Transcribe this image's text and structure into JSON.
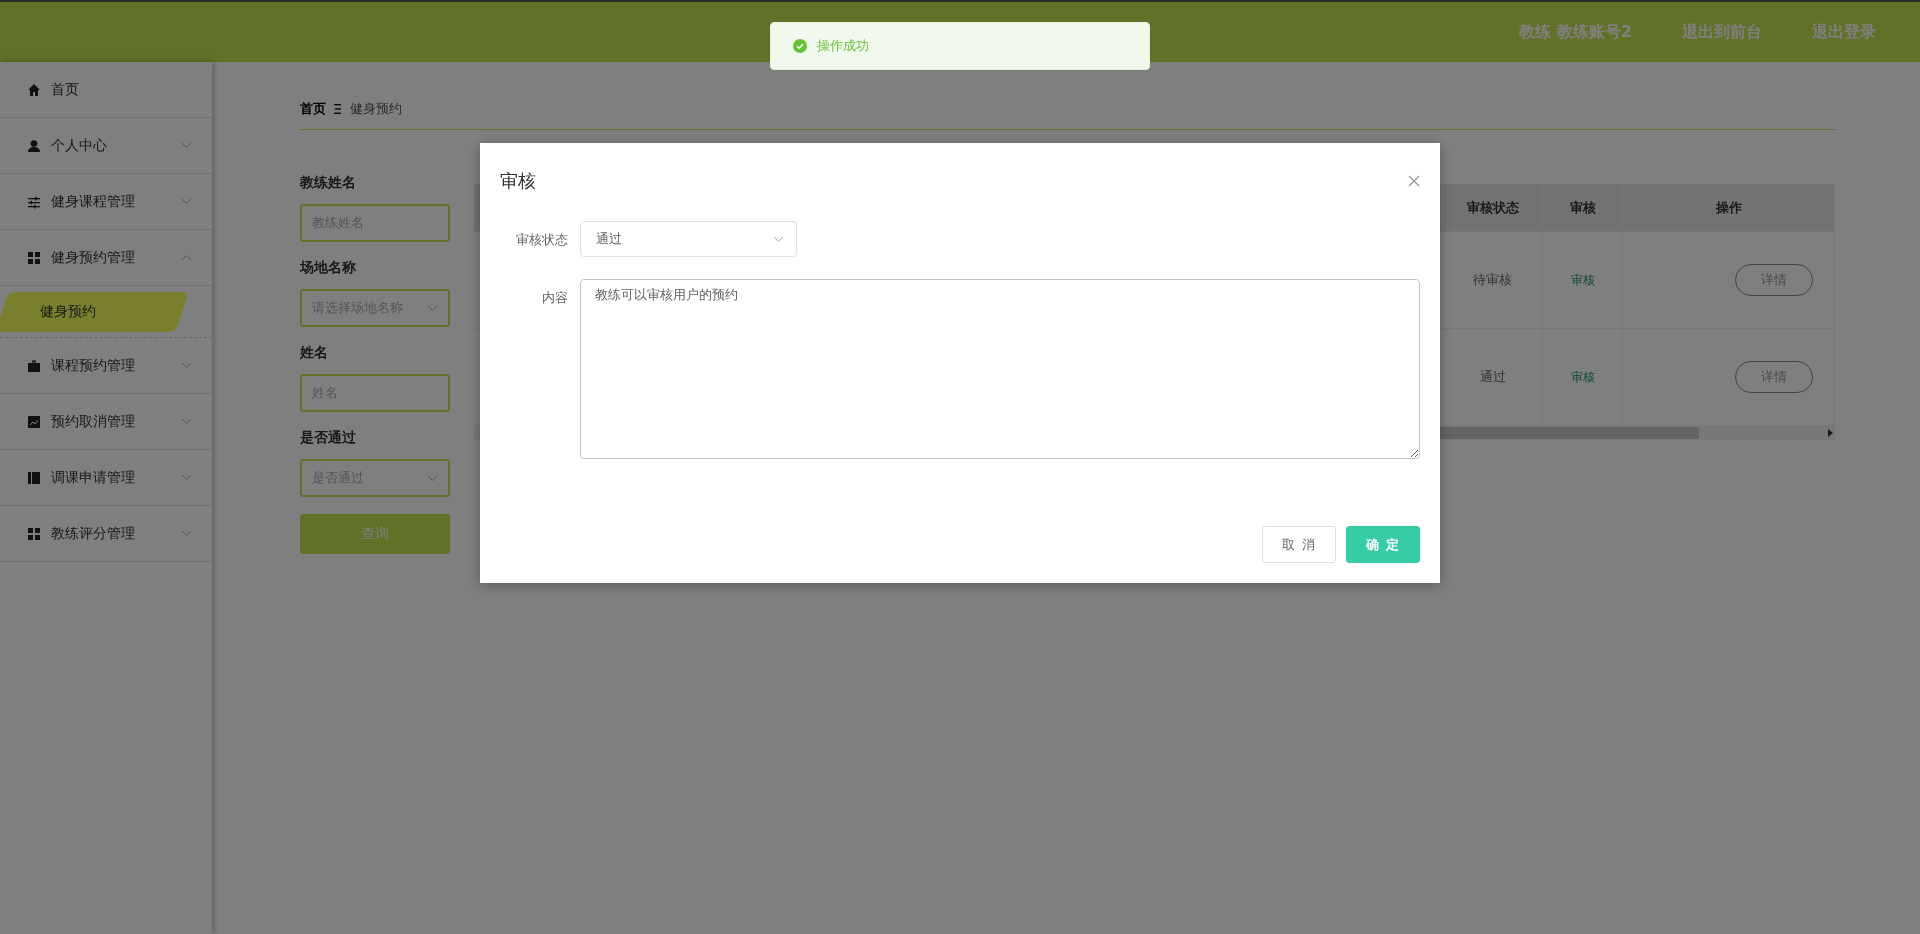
{
  "topbar": {
    "user_label": "教练 教练账号2",
    "links": [
      "退出到前台",
      "退出登录"
    ]
  },
  "toast": {
    "text": "操作成功"
  },
  "sidebar": {
    "items": [
      {
        "label": "首页"
      },
      {
        "label": "个人中心",
        "expanded": false
      },
      {
        "label": "健身课程管理",
        "expanded": false
      },
      {
        "label": "健身预约管理",
        "expanded": true,
        "children": [
          {
            "label": "健身预约",
            "selected": true
          }
        ]
      },
      {
        "label": "课程预约管理",
        "expanded": false
      },
      {
        "label": "预约取消管理",
        "expanded": false
      },
      {
        "label": "调课申请管理",
        "expanded": false
      },
      {
        "label": "教练评分管理",
        "expanded": false
      }
    ]
  },
  "breadcrumb": [
    "首页",
    "健身预约"
  ],
  "filters": [
    {
      "label": "教练姓名",
      "kind": "input",
      "placeholder": "教练姓名"
    },
    {
      "label": "场地名称",
      "kind": "select",
      "placeholder": "请选择场地名称"
    },
    {
      "label": "姓名",
      "kind": "input",
      "placeholder": "姓名"
    },
    {
      "label": "是否通过",
      "kind": "select",
      "placeholder": "是否通过"
    }
  ],
  "search_button": "查询",
  "table": {
    "columns": [
      "审核状态",
      "审核",
      "操作"
    ],
    "rows": [
      {
        "status": "待审核",
        "review": "审核",
        "action": "详情"
      },
      {
        "status": "通过",
        "review": "审核",
        "action": "详情"
      }
    ]
  },
  "modal": {
    "title": "审核",
    "fields": [
      {
        "label": "审核状态",
        "kind": "select",
        "value": "通过"
      },
      {
        "label": "内容",
        "kind": "textarea",
        "value": "教练可以审核用户的预约"
      }
    ],
    "buttons": [
      {
        "label": "取 消",
        "kind": "default"
      },
      {
        "label": "确 定",
        "kind": "primary"
      }
    ]
  }
}
